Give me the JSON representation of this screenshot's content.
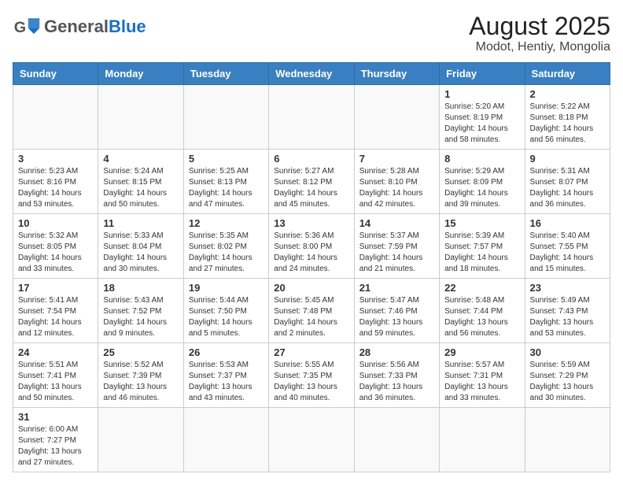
{
  "header": {
    "logo_general": "General",
    "logo_blue": "Blue",
    "month_title": "August 2025",
    "location": "Modot, Hentiy, Mongolia"
  },
  "weekdays": [
    "Sunday",
    "Monday",
    "Tuesday",
    "Wednesday",
    "Thursday",
    "Friday",
    "Saturday"
  ],
  "weeks": [
    [
      {
        "day": "",
        "info": ""
      },
      {
        "day": "",
        "info": ""
      },
      {
        "day": "",
        "info": ""
      },
      {
        "day": "",
        "info": ""
      },
      {
        "day": "",
        "info": ""
      },
      {
        "day": "1",
        "info": "Sunrise: 5:20 AM\nSunset: 8:19 PM\nDaylight: 14 hours and 58 minutes."
      },
      {
        "day": "2",
        "info": "Sunrise: 5:22 AM\nSunset: 8:18 PM\nDaylight: 14 hours and 56 minutes."
      }
    ],
    [
      {
        "day": "3",
        "info": "Sunrise: 5:23 AM\nSunset: 8:16 PM\nDaylight: 14 hours and 53 minutes."
      },
      {
        "day": "4",
        "info": "Sunrise: 5:24 AM\nSunset: 8:15 PM\nDaylight: 14 hours and 50 minutes."
      },
      {
        "day": "5",
        "info": "Sunrise: 5:25 AM\nSunset: 8:13 PM\nDaylight: 14 hours and 47 minutes."
      },
      {
        "day": "6",
        "info": "Sunrise: 5:27 AM\nSunset: 8:12 PM\nDaylight: 14 hours and 45 minutes."
      },
      {
        "day": "7",
        "info": "Sunrise: 5:28 AM\nSunset: 8:10 PM\nDaylight: 14 hours and 42 minutes."
      },
      {
        "day": "8",
        "info": "Sunrise: 5:29 AM\nSunset: 8:09 PM\nDaylight: 14 hours and 39 minutes."
      },
      {
        "day": "9",
        "info": "Sunrise: 5:31 AM\nSunset: 8:07 PM\nDaylight: 14 hours and 36 minutes."
      }
    ],
    [
      {
        "day": "10",
        "info": "Sunrise: 5:32 AM\nSunset: 8:05 PM\nDaylight: 14 hours and 33 minutes."
      },
      {
        "day": "11",
        "info": "Sunrise: 5:33 AM\nSunset: 8:04 PM\nDaylight: 14 hours and 30 minutes."
      },
      {
        "day": "12",
        "info": "Sunrise: 5:35 AM\nSunset: 8:02 PM\nDaylight: 14 hours and 27 minutes."
      },
      {
        "day": "13",
        "info": "Sunrise: 5:36 AM\nSunset: 8:00 PM\nDaylight: 14 hours and 24 minutes."
      },
      {
        "day": "14",
        "info": "Sunrise: 5:37 AM\nSunset: 7:59 PM\nDaylight: 14 hours and 21 minutes."
      },
      {
        "day": "15",
        "info": "Sunrise: 5:39 AM\nSunset: 7:57 PM\nDaylight: 14 hours and 18 minutes."
      },
      {
        "day": "16",
        "info": "Sunrise: 5:40 AM\nSunset: 7:55 PM\nDaylight: 14 hours and 15 minutes."
      }
    ],
    [
      {
        "day": "17",
        "info": "Sunrise: 5:41 AM\nSunset: 7:54 PM\nDaylight: 14 hours and 12 minutes."
      },
      {
        "day": "18",
        "info": "Sunrise: 5:43 AM\nSunset: 7:52 PM\nDaylight: 14 hours and 9 minutes."
      },
      {
        "day": "19",
        "info": "Sunrise: 5:44 AM\nSunset: 7:50 PM\nDaylight: 14 hours and 5 minutes."
      },
      {
        "day": "20",
        "info": "Sunrise: 5:45 AM\nSunset: 7:48 PM\nDaylight: 14 hours and 2 minutes."
      },
      {
        "day": "21",
        "info": "Sunrise: 5:47 AM\nSunset: 7:46 PM\nDaylight: 13 hours and 59 minutes."
      },
      {
        "day": "22",
        "info": "Sunrise: 5:48 AM\nSunset: 7:44 PM\nDaylight: 13 hours and 56 minutes."
      },
      {
        "day": "23",
        "info": "Sunrise: 5:49 AM\nSunset: 7:43 PM\nDaylight: 13 hours and 53 minutes."
      }
    ],
    [
      {
        "day": "24",
        "info": "Sunrise: 5:51 AM\nSunset: 7:41 PM\nDaylight: 13 hours and 50 minutes."
      },
      {
        "day": "25",
        "info": "Sunrise: 5:52 AM\nSunset: 7:39 PM\nDaylight: 13 hours and 46 minutes."
      },
      {
        "day": "26",
        "info": "Sunrise: 5:53 AM\nSunset: 7:37 PM\nDaylight: 13 hours and 43 minutes."
      },
      {
        "day": "27",
        "info": "Sunrise: 5:55 AM\nSunset: 7:35 PM\nDaylight: 13 hours and 40 minutes."
      },
      {
        "day": "28",
        "info": "Sunrise: 5:56 AM\nSunset: 7:33 PM\nDaylight: 13 hours and 36 minutes."
      },
      {
        "day": "29",
        "info": "Sunrise: 5:57 AM\nSunset: 7:31 PM\nDaylight: 13 hours and 33 minutes."
      },
      {
        "day": "30",
        "info": "Sunrise: 5:59 AM\nSunset: 7:29 PM\nDaylight: 13 hours and 30 minutes."
      }
    ],
    [
      {
        "day": "31",
        "info": "Sunrise: 6:00 AM\nSunset: 7:27 PM\nDaylight: 13 hours and 27 minutes."
      },
      {
        "day": "",
        "info": ""
      },
      {
        "day": "",
        "info": ""
      },
      {
        "day": "",
        "info": ""
      },
      {
        "day": "",
        "info": ""
      },
      {
        "day": "",
        "info": ""
      },
      {
        "day": "",
        "info": ""
      }
    ]
  ]
}
